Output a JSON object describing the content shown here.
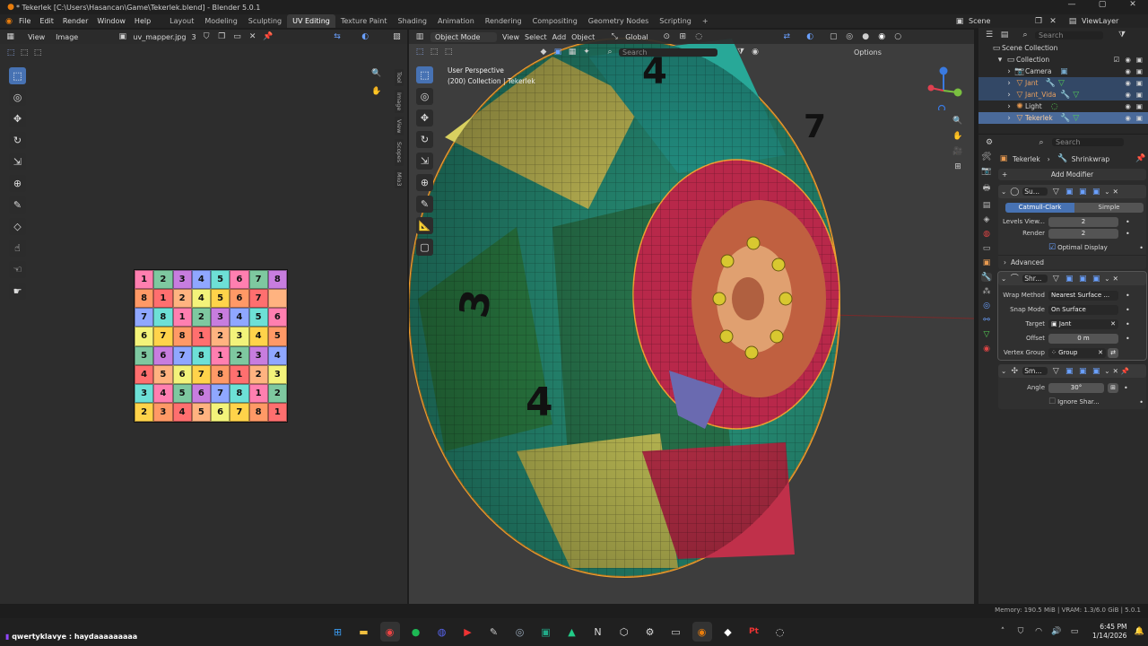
{
  "window": {
    "title": "* Tekerlek [C:\\Users\\Hasancan\\Game\\Tekerlek.blend] - Blender 5.0.1",
    "controls": [
      "—",
      "▢",
      "✕"
    ]
  },
  "menu": {
    "items": [
      "File",
      "Edit",
      "Render",
      "Window",
      "Help"
    ],
    "workspaces": [
      "Layout",
      "Modeling",
      "Sculpting",
      "UV Editing",
      "Texture Paint",
      "Shading",
      "Animation",
      "Rendering",
      "Compositing",
      "Geometry Nodes",
      "Scripting"
    ],
    "active_workspace": "UV Editing",
    "add_workspace": "+",
    "scene": "Scene",
    "view_layer": "ViewLayer"
  },
  "uv_editor": {
    "menus": [
      "View",
      "Image"
    ],
    "image_name": "uv_mapper.jpg",
    "users": "3",
    "side_tabs": [
      "Tool",
      "Image",
      "View",
      "Scopes",
      "Mio3"
    ],
    "texture_grid": [
      [
        "1",
        "2",
        "3",
        "4",
        "5",
        "6",
        "7",
        "8"
      ],
      [
        "8",
        "1",
        "2",
        "4",
        "5",
        "6",
        "7",
        ""
      ],
      [
        "7",
        "8",
        "1",
        "2",
        "3",
        "4",
        "5",
        "6"
      ],
      [
        "6",
        "7",
        "8",
        "1",
        "2",
        "3",
        "4",
        "5"
      ],
      [
        "5",
        "6",
        "7",
        "8",
        "1",
        "2",
        "3",
        "4"
      ],
      [
        "4",
        "5",
        "6",
        "7",
        "8",
        "1",
        "2",
        "3"
      ],
      [
        "3",
        "4",
        "5",
        "6",
        "7",
        "8",
        "1",
        "2"
      ],
      [
        "2",
        "3",
        "4",
        "5",
        "6",
        "7",
        "8",
        "1"
      ]
    ],
    "grid_colors": [
      "#ff7fb0",
      "#ffd34a",
      "#7ec8a0",
      "#ff9966",
      "#c77ddf",
      "#ff6f6f",
      "#8fa7ff",
      "#ffb380",
      "#6de0d6",
      "#f3f37a"
    ]
  },
  "viewport": {
    "mode": "Object Mode",
    "menus": [
      "View",
      "Select",
      "Add",
      "Object"
    ],
    "orientation": "Global",
    "search_placeholder": "Search",
    "options_label": "Options",
    "perspective_label": "User Perspective",
    "collection_label": "(200) Collection | Tekerlek"
  },
  "outliner": {
    "search_placeholder": "Search",
    "root": "Scene Collection",
    "collection": "Collection",
    "items": [
      "Camera",
      "Jant",
      "Jant_Vida",
      "Light",
      "Tekerlek"
    ]
  },
  "properties": {
    "search_placeholder": "Search",
    "object_name": "Tekerlek",
    "active_modifier": "Shrinkwrap",
    "add_modifier": "Add Modifier",
    "subsurf": {
      "name": "Su...",
      "mode_a": "Catmull-Clark",
      "mode_b": "Simple",
      "levels_label": "Levels View...",
      "levels_value": "2",
      "render_label": "Render",
      "render_value": "2",
      "optimal_display": "Optimal Display",
      "advanced": "Advanced"
    },
    "shrinkwrap": {
      "name": "Shr...",
      "wrap_method_label": "Wrap Method",
      "wrap_method": "Nearest Surface ...",
      "snap_mode_label": "Snap Mode",
      "snap_mode": "On Surface",
      "target_label": "Target",
      "target": "Jant",
      "offset_label": "Offset",
      "offset": "0 m",
      "vertex_group_label": "Vertex Group",
      "vertex_group": "Group"
    },
    "smooth": {
      "name": "Sm...",
      "angle_label": "Angle",
      "angle": "30°",
      "ignore_sharp": "Ignore Shar..."
    }
  },
  "status": {
    "memory": "Memory: 190.5 MiB | VRAM: 1.3/6.0 GiB | 5.0.1"
  },
  "taskbar": {
    "chat_user": "qwertyklavye",
    "chat_message": "haydaaaaaaaaa",
    "time": "6:45 PM",
    "date": "1/14/2026"
  },
  "colors": {
    "accent": "#4772b3",
    "outline_orange": "#f0a030",
    "header_bg": "#2b2b2b",
    "panel_bg": "#303030"
  }
}
